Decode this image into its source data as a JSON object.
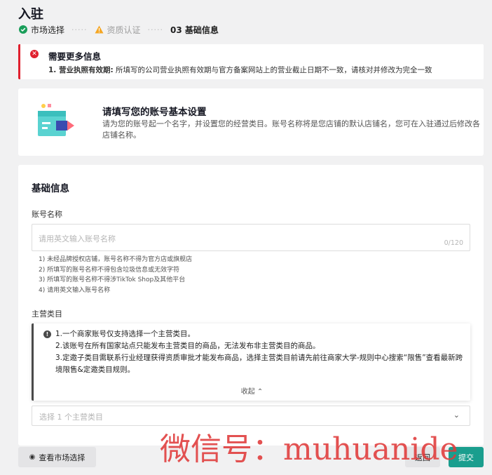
{
  "page_title": "入驻",
  "steps": [
    {
      "label": "市场选择",
      "status": "done"
    },
    {
      "label": "资质认证",
      "status": "warning"
    },
    {
      "label": "03 基础信息",
      "status": "current"
    }
  ],
  "alert": {
    "title": "需要更多信息",
    "item_prefix": "1. 营业执照有效期:",
    "item_text": " 所填写的公司营业执照有效期与官方备案网站上的营业截止日期不一致，请核对并修改为完全一致"
  },
  "intro": {
    "title": "请填写您的账号基本设置",
    "desc": "请为您的账号起一个名字，并设置您的经营类目。账号名称将是您店铺的默认店铺名，您可在入驻通过后修改各店铺名称。"
  },
  "form": {
    "section_title": "基础信息",
    "account_name": {
      "label": "账号名称",
      "placeholder": "请用英文输入账号名称",
      "counter": "0/120",
      "rules": [
        "1) 未经品牌授权店铺，账号名称不得为官方店或旗舰店",
        "2) 所填写的账号名称不得包含垃圾信息或无效字符",
        "3) 所填写的账号名称不得涉TikTok Shop及其他平台",
        "4) 请用英文输入账号名称"
      ]
    },
    "main_category": {
      "label": "主营类目",
      "info_lines": [
        "1.一个商家账号仅支持选择一个主营类目。",
        "2.该账号在所有国家站点只能发布主营类目的商品，无法发布非主营类目的商品。",
        "3.定邀子类目需联系行业经理获得资质审批才能发布商品，选择主营类目前请先前往商家大学-规则中心搜索“限售”查看最新跨境限售&定邀类目规则。"
      ],
      "collapse_label": "收起",
      "select_placeholder": "选择 1 个主营类目"
    }
  },
  "footer": {
    "view_market_label": "查看市场选择",
    "back_label": "返回",
    "submit_label": "提交"
  },
  "watermark": "微信号：muhuanide",
  "colors": {
    "accent": "#1a9e8e",
    "error": "#e0202e",
    "success": "#1a9e5a",
    "warning": "#f5a623"
  }
}
